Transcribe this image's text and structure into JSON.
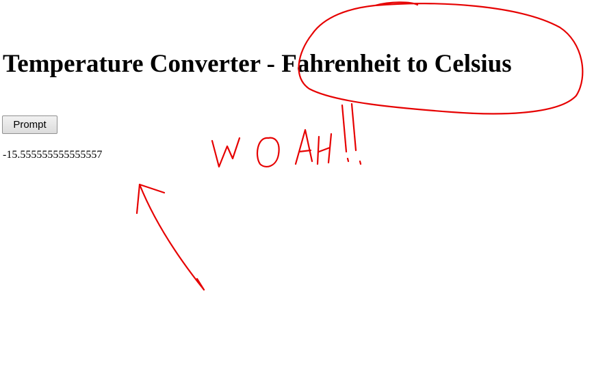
{
  "page": {
    "title": "Temperature Converter - Fahrenheit to Celsius",
    "prompt_button_label": "Prompt",
    "result": "-15.555555555555557"
  },
  "annotations": {
    "handwritten_text": "WOAH!!",
    "color": "#e60000"
  }
}
